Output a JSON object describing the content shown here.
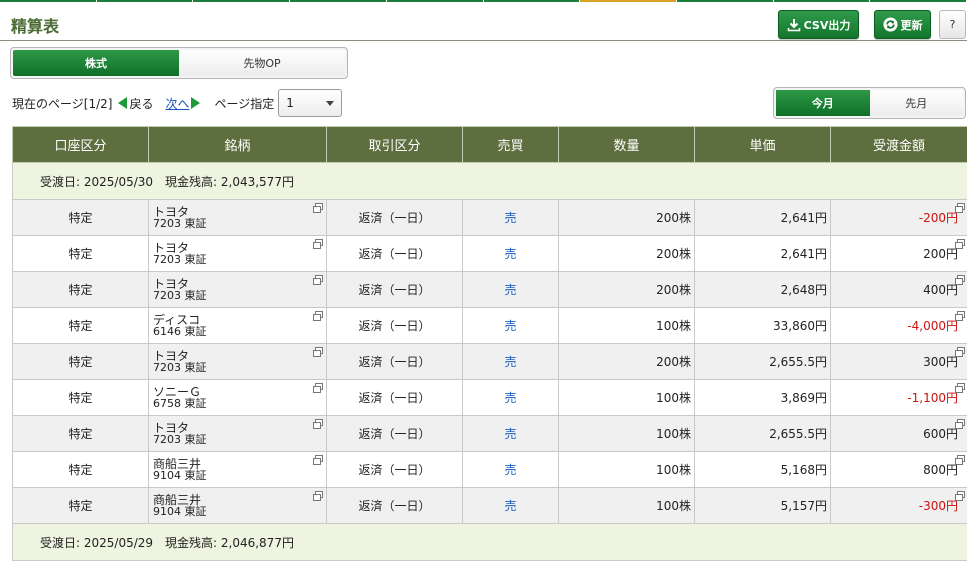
{
  "header": {
    "title": "精算表",
    "csv_label": "CSV出力",
    "refresh_label": "更新",
    "help_label": "?"
  },
  "type_tabs": {
    "stock": "株式",
    "futures": "先物OP"
  },
  "pager": {
    "current": "現在のページ[1/2]",
    "prev": "戻る",
    "next": "次へ",
    "page_spec": "ページ指定",
    "page_value": "1"
  },
  "month_tabs": {
    "this_month": "今月",
    "prev_month": "先月"
  },
  "table": {
    "headers": [
      "口座区分",
      "銘柄",
      "取引区分",
      "売買",
      "数量",
      "単価",
      "受渡金額"
    ],
    "groups": [
      {
        "date_label": "受渡日: 2025/05/30　現金残高: 2,043,577円",
        "rows": [
          {
            "account": "特定",
            "name": "トヨタ",
            "code": "7203 東証",
            "trade": "返済（一日）",
            "side": "売",
            "qty": "200株",
            "price": "2,641円",
            "amount": "-200円",
            "negative": true
          },
          {
            "account": "特定",
            "name": "トヨタ",
            "code": "7203 東証",
            "trade": "返済（一日）",
            "side": "売",
            "qty": "200株",
            "price": "2,641円",
            "amount": "200円",
            "negative": false
          },
          {
            "account": "特定",
            "name": "トヨタ",
            "code": "7203 東証",
            "trade": "返済（一日）",
            "side": "売",
            "qty": "200株",
            "price": "2,648円",
            "amount": "400円",
            "negative": false
          },
          {
            "account": "特定",
            "name": "ディスコ",
            "code": "6146 東証",
            "trade": "返済（一日）",
            "side": "売",
            "qty": "100株",
            "price": "33,860円",
            "amount": "-4,000円",
            "negative": true
          },
          {
            "account": "特定",
            "name": "トヨタ",
            "code": "7203 東証",
            "trade": "返済（一日）",
            "side": "売",
            "qty": "200株",
            "price": "2,655.5円",
            "amount": "300円",
            "negative": false
          },
          {
            "account": "特定",
            "name": "ソニーＧ",
            "code": "6758 東証",
            "trade": "返済（一日）",
            "side": "売",
            "qty": "100株",
            "price": "3,869円",
            "amount": "-1,100円",
            "negative": true
          },
          {
            "account": "特定",
            "name": "トヨタ",
            "code": "7203 東証",
            "trade": "返済（一日）",
            "side": "売",
            "qty": "100株",
            "price": "2,655.5円",
            "amount": "600円",
            "negative": false
          },
          {
            "account": "特定",
            "name": "商船三井",
            "code": "9104 東証",
            "trade": "返済（一日）",
            "side": "売",
            "qty": "100株",
            "price": "5,168円",
            "amount": "800円",
            "negative": false
          },
          {
            "account": "特定",
            "name": "商船三井",
            "code": "9104 東証",
            "trade": "返済（一日）",
            "side": "売",
            "qty": "100株",
            "price": "5,157円",
            "amount": "-300円",
            "negative": true
          }
        ]
      },
      {
        "date_label": "受渡日: 2025/05/29　現金残高: 2,046,877円",
        "rows": []
      }
    ]
  },
  "colors": {
    "brand_green": "#12762d",
    "header_olive": "#5d6f3f",
    "title_green": "#4b6a34",
    "negative_red": "#cc1111",
    "sell_blue": "#1a5fbf"
  }
}
